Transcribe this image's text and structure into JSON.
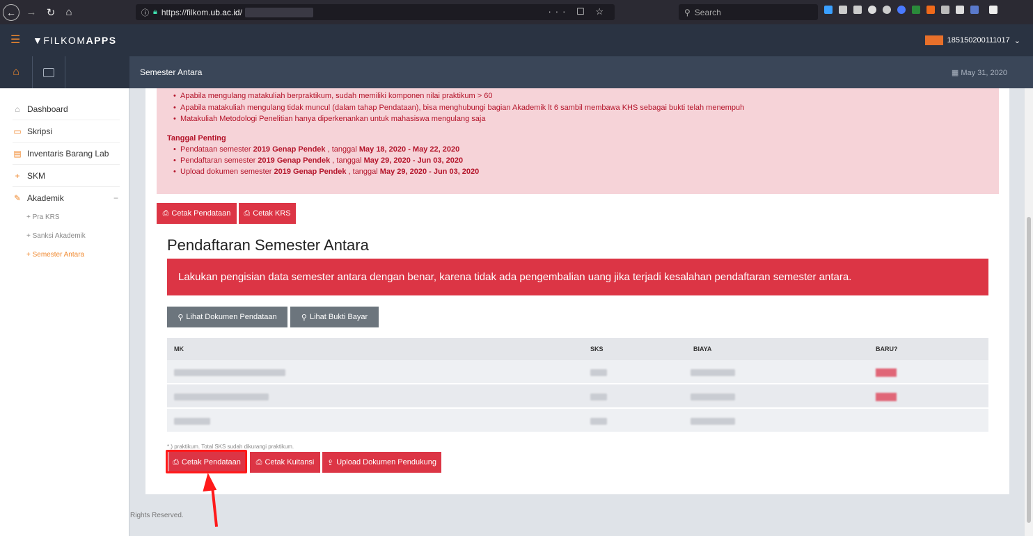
{
  "browser": {
    "url": "https://filkom.",
    "url_domain": "ub.ac.id",
    "url_path": "/",
    "url_actions": "··· ☐ ☆",
    "search_placeholder": "Search"
  },
  "app": {
    "logo_prefix": "FILKOM",
    "logo_suffix": "APPS",
    "user_id": "185150200111017",
    "page_title": "Semester Antara",
    "date": "May 31, 2020"
  },
  "sidebar": {
    "items": [
      {
        "label": "Dashboard",
        "icon": "home-icon"
      },
      {
        "label": "Skripsi",
        "icon": "folder-icon"
      },
      {
        "label": "Inventaris Barang Lab",
        "icon": "box-icon"
      },
      {
        "label": "SKM",
        "icon": "plus-icon"
      },
      {
        "label": "Akademik",
        "icon": "edit-icon",
        "expanded_marker": "−"
      }
    ],
    "subitems": [
      {
        "label": "+ Pra KRS"
      },
      {
        "label": "+ Sanksi Akademik"
      },
      {
        "label": "+ Semester Antara"
      }
    ]
  },
  "notice": {
    "bullets": [
      "Apabila mengulang matakuliah berpraktikum, sudah memiliki komponen nilai praktikum > 60",
      "Apabila matakuliah mengulang tidak muncul (dalam tahap Pendataan), bisa menghubungi bagian Akademik lt 6 sambil membawa KHS sebagai bukti telah menempuh",
      "Matakuliah Metodologi Penelitian hanya diperkenankan untuk mahasiswa mengulang saja"
    ],
    "important_title": "Tanggal Penting",
    "dates": [
      {
        "prefix": "Pendataan semester ",
        "semester": "2019 Genap Pendek",
        "mid": " , tanggal ",
        "range": "May 18, 2020 - May 22, 2020"
      },
      {
        "prefix": "Pendaftaran semester ",
        "semester": "2019 Genap Pendek",
        "mid": " , tanggal ",
        "range": "May 29, 2020 - Jun 03, 2020"
      },
      {
        "prefix": "Upload dokumen semester ",
        "semester": "2019 Genap Pendek",
        "mid": " , tanggal ",
        "range": "May 29, 2020 - Jun 03, 2020"
      }
    ]
  },
  "top_buttons": {
    "cetak_pendataan": "Cetak Pendataan",
    "cetak_krs": "Cetak KRS"
  },
  "section": {
    "title": "Pendaftaran Semester Antara",
    "warning": "Lakukan pengisian data semester antara dengan benar, karena tidak ada pengembalian uang jika terjadi kesalahan pendaftaran semester antara."
  },
  "doc_buttons": {
    "lihat_dokumen": "Lihat Dokumen Pendataan",
    "lihat_bukti": "Lihat Bukti Bayar"
  },
  "table": {
    "headers": [
      "MK",
      "SKS",
      "BIAYA",
      "BARU?"
    ]
  },
  "footnote": "*.) praktikum. Total SKS sudah dikurangi praktikum.",
  "bottom_buttons": {
    "cetak_pendataan": "Cetak Pendataan",
    "cetak_kuitansi": "Cetak Kuitansi",
    "upload": "Upload Dokumen Pendukung"
  },
  "footer": "Rights Reserved.",
  "colors": {
    "header_bg": "#2a3342",
    "accent": "#f0882e",
    "danger": "#dc3545",
    "notice_bg": "#f6d3d8",
    "annotation": "#ff1a1a"
  }
}
